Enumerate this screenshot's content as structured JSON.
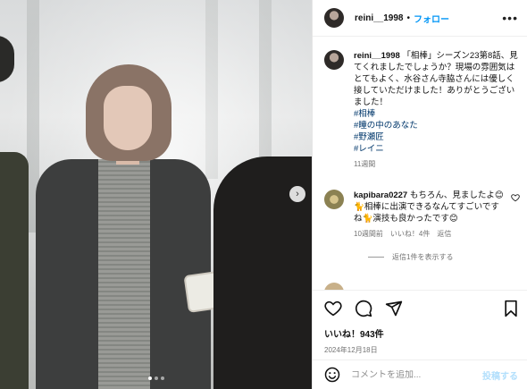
{
  "photo": {
    "next_icon": "chevron-right-icon",
    "carousel_dots": 3,
    "active_dot": 1
  },
  "header": {
    "username": "reini__1998",
    "separator": "•",
    "follow_label": "フォロー",
    "more_icon": "more-horizontal-icon",
    "more_label": "•••"
  },
  "post": {
    "username": "reini__1998",
    "caption": "「相棒」シーズン23第8話、見てくれましたでしょうか？現場の雰囲気はとてもよく、水谷さん寺脇さんには優しく接していただけました！ありがとうございました！",
    "hashtags": [
      "#相棒",
      "#瞳の中のあなた",
      "#野瀬匠",
      "#レイニ"
    ],
    "ago": "11週間"
  },
  "comment": {
    "username": "kapibara0227",
    "text": "もちろん、見ましたよ😊🐈相棒に出演できるなんてすごいですね🐈演技も良かったです😊",
    "ago": "10週間前",
    "likes": "いいね！4件",
    "reply": "返信",
    "view_replies": "返信1件を表示する",
    "like_icon": "heart-outline-icon"
  },
  "actions": {
    "icons": [
      "heart-icon",
      "comment-icon",
      "share-icon",
      "bookmark-icon"
    ],
    "likes": "いいね！943件",
    "date": "2024年12月18日"
  },
  "comment_input": {
    "placeholder": "コメントを追加...",
    "post_label": "投稿する",
    "emoji_icon": "smiley-icon"
  },
  "colors": {
    "link": "#0095f6",
    "hashtag": "#00376b",
    "muted": "#737373"
  }
}
